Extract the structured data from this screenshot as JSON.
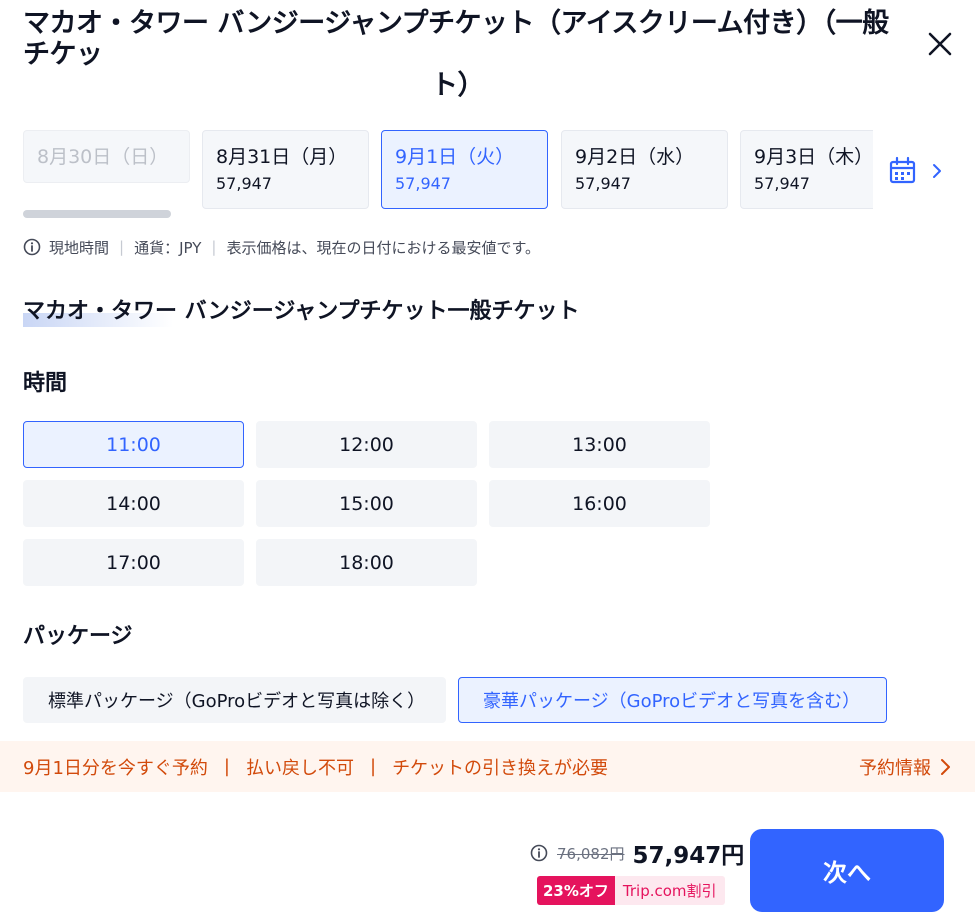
{
  "header": {
    "title_line1": "マカオ・タワー バンジージャンプチケット（アイスクリーム付き）（一般チケッ",
    "title_line2": "ト）"
  },
  "dates": [
    {
      "label": "8月30日（日）",
      "price": "",
      "state": "disabled"
    },
    {
      "label": "8月31日（月）",
      "price": "57,947",
      "state": "normal"
    },
    {
      "label": "9月1日（火）",
      "price": "57,947",
      "state": "selected"
    },
    {
      "label": "9月2日（水）",
      "price": "57,947",
      "state": "normal"
    },
    {
      "label": "9月3日（木）",
      "price": "57,947",
      "state": "normal"
    }
  ],
  "info": {
    "local_time": "現地時間",
    "currency": "通貨：JPY",
    "price_note": "表示価格は、現在の日付における最安値です。"
  },
  "package_title": "マカオ・タワー バンジージャンプチケット一般チケット",
  "time_section": {
    "label": "時間",
    "slots": [
      "11:00",
      "12:00",
      "13:00",
      "14:00",
      "15:00",
      "16:00",
      "17:00",
      "18:00"
    ],
    "selected": "11:00"
  },
  "package_section": {
    "label": "パッケージ",
    "options": [
      {
        "label": "標準パッケージ（GoProビデオと写真は除く）",
        "selected": false
      },
      {
        "label": "豪華パッケージ（GoProビデオと写真を含む）",
        "selected": true
      }
    ]
  },
  "notice": {
    "item1": "9月1日分を今すぐ予約",
    "item2": "払い戻し不可",
    "item3": "チケットの引き換えが必要",
    "separator": "|",
    "link": "予約情報"
  },
  "price": {
    "original": "76,082円",
    "current": "57,947円",
    "discount": "23%オフ",
    "discount_tag": "Trip.com割引"
  },
  "next_button": "次へ",
  "colors": {
    "accent": "#3264ff",
    "notice_text": "#d24a0b",
    "notice_bg": "#fff5ef",
    "discount": "#e5135d"
  },
  "icons": {
    "close": "close-icon",
    "calendar": "calendar-icon",
    "chevron": "chevron-right-icon",
    "info": "info-icon"
  }
}
